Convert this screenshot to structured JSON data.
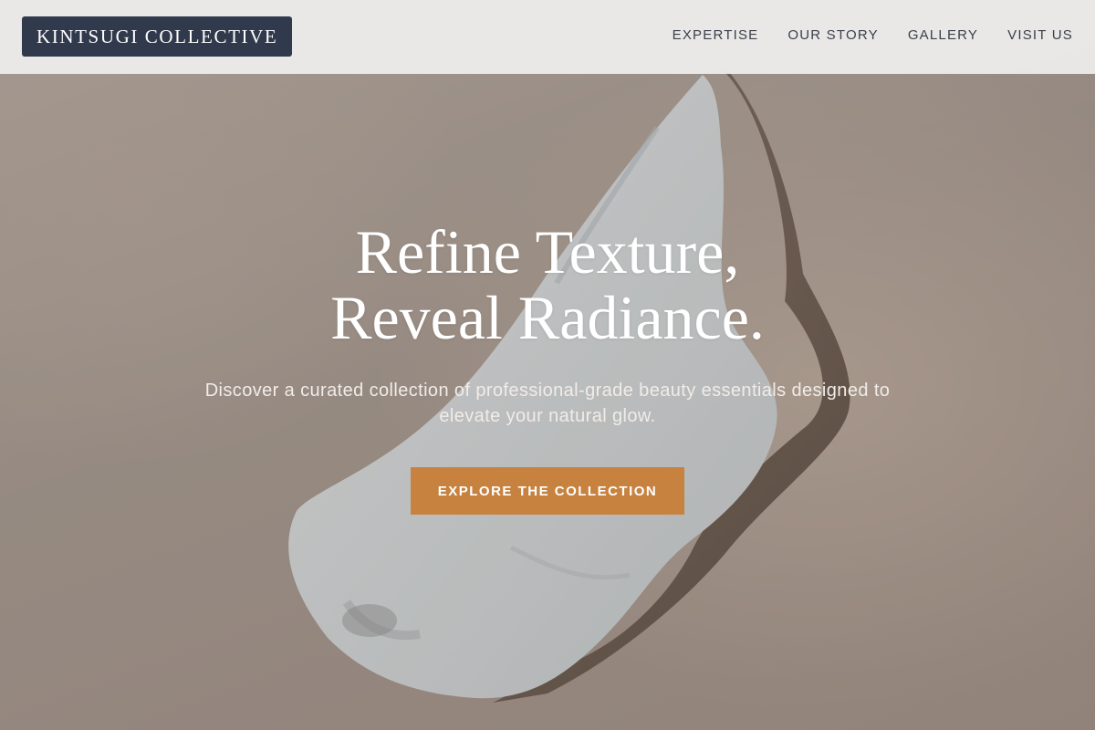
{
  "header": {
    "logo_text": "KINTSUGI COLLECTIVE",
    "nav": [
      {
        "label": "EXPERTISE"
      },
      {
        "label": "OUR STORY"
      },
      {
        "label": "GALLERY"
      },
      {
        "label": "VISIT US"
      }
    ]
  },
  "hero": {
    "headline_line1": "Refine Texture,",
    "headline_line2": "Reveal Radiance.",
    "subtext": "Discover a curated collection of professional-grade beauty essentials designed to elevate your natural glow.",
    "cta_label": "EXPLORE THE COLLECTION",
    "background_image": "cream-smear-photo"
  },
  "colors": {
    "logo_background": "#313a4c",
    "header_background": "#ecebea",
    "cta_background": "#c8823f",
    "nav_text": "#3a3f4a",
    "hero_background": "#a4998f"
  }
}
